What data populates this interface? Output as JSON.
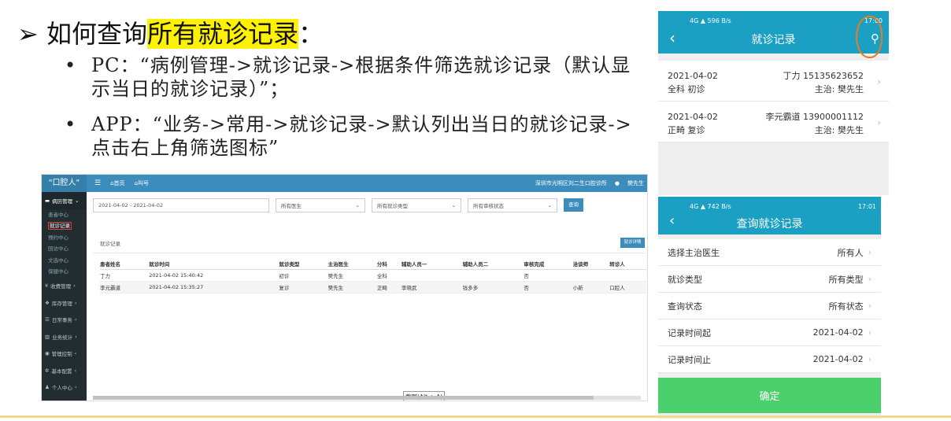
{
  "slide": {
    "arrow": "➢",
    "title_pre": "如何查询",
    "title_highlight": "所有就诊记录",
    "title_post": "：",
    "bullets": [
      "PC：“病例管理->就诊记录->根据条件筛选就诊记录（默认显示当日的就诊记录）”；",
      "APP：“业务->常用->就诊记录->默认列出当日的就诊记录->点击右上角筛选图标”"
    ]
  },
  "pc": {
    "brand": "\"口腔人\"",
    "nav": [
      "首页",
      "叫号"
    ],
    "clinic": "深圳市光明区刘二生口腔诊所",
    "user": "樊先生",
    "sidebar": {
      "open_group": "病历管理",
      "sub_items": [
        "患者中心",
        "就诊记录",
        "预约中心",
        "回访中心",
        "文选中心",
        "保健中心"
      ],
      "groups": [
        "收费管理",
        "库存管理",
        "日常事务",
        "业务统计",
        "管理控制",
        "基本配置",
        "个人中心"
      ]
    },
    "filters": {
      "date_range": "2021-04-02 - 2021-04-02",
      "doctor": "所有医生",
      "visit_type": "所有就诊类型",
      "review_status": "所有审核状态",
      "query_button": "查询"
    },
    "section_label": "就诊记录",
    "detail_button": "就诊详情",
    "table": {
      "headers": [
        "患者姓名",
        "就诊时间",
        "就诊类型",
        "主治医生",
        "分科",
        "辅助人员一",
        "辅助人员二",
        "审核完成",
        "洽谈师",
        "转诊人"
      ],
      "rows": [
        [
          "丁力",
          "2021-04-02 15:40:42",
          "初诊",
          "樊先生",
          "全科",
          "",
          "",
          "否",
          "",
          ""
        ],
        [
          "李元霸道",
          "2021-04-02 15:35:27",
          "复诊",
          "樊先生",
          "正畸",
          "李晓武",
          "钱多多",
          "否",
          "小新",
          "口腔人"
        ]
      ]
    },
    "tooltip": "截图(Alt + A)"
  },
  "app_list": {
    "status_left": "4G ▲ 596 B/s",
    "status_right": "17:00",
    "title": "就诊记录",
    "items": [
      {
        "date": "2021-04-02",
        "patient": "丁力 15135623652",
        "dept_type": "全科 初诊",
        "doctor": "主治: 樊先生"
      },
      {
        "date": "2021-04-02",
        "patient": "李元霸道 13900001112",
        "dept_type": "正畸 复诊",
        "doctor": "主治: 樊先生"
      }
    ]
  },
  "app_filter": {
    "status_left": "4G ▲ 742 B/s",
    "status_right": "17:01",
    "title": "查询就诊记录",
    "rows": [
      {
        "label": "选择主治医生",
        "value": "所有人"
      },
      {
        "label": "就诊类型",
        "value": "所有类型"
      },
      {
        "label": "查询状态",
        "value": "所有状态"
      },
      {
        "label": "记录时间起",
        "value": "2021-04-02"
      },
      {
        "label": "记录时间止",
        "value": "2021-04-02"
      }
    ],
    "confirm": "确定"
  }
}
